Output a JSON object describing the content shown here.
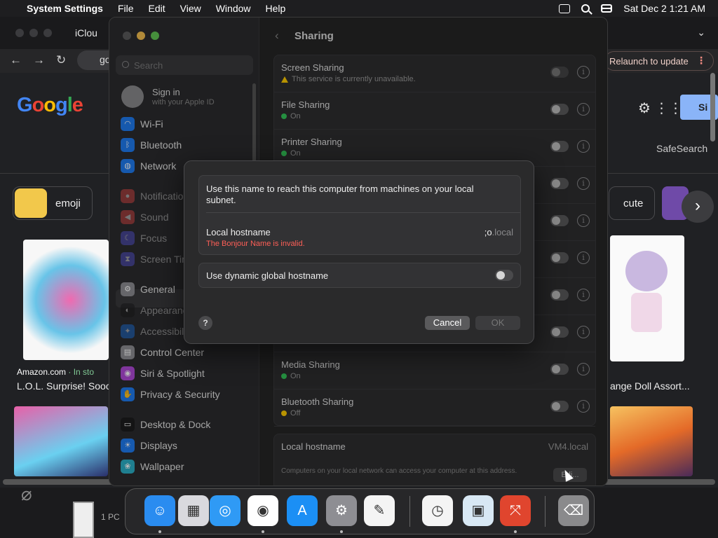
{
  "menubar": {
    "app": "System Settings",
    "items": [
      "File",
      "Edit",
      "View",
      "Window",
      "Help"
    ],
    "datetime": "Sat Dec 2  1:21 AM"
  },
  "browser": {
    "tab_title": "iClou",
    "url": "go",
    "relaunch": "Relaunch to update",
    "google": [
      "G",
      "o",
      "o",
      "g",
      "l",
      "e"
    ],
    "google_colors": [
      "#4285f4",
      "#ea4335",
      "#fbbc05",
      "#4285f4",
      "#34a853",
      "#ea4335"
    ],
    "signin": "Si",
    "safesearch": "SafeSearch",
    "chip_emoji": "emoji",
    "chip_cute": "cute",
    "source_store": "Amazon.com",
    "source_suffix": " · In sto",
    "title_left": "L.O.L. Surprise! Sooo",
    "title_right": "ange Doll Assort...",
    "taskbar_label": "1 PC"
  },
  "settings": {
    "search_placeholder": "Search",
    "signin_title": "Sign in",
    "signin_sub": "with your Apple ID",
    "sidebar": [
      {
        "label": "Wi-Fi",
        "icon": "wifi-icon",
        "color": "#1f7cf2",
        "glyph": "◠"
      },
      {
        "label": "Bluetooth",
        "icon": "bluetooth-icon",
        "color": "#1f7cf2",
        "glyph": "ᛒ"
      },
      {
        "label": "Network",
        "icon": "globe-icon",
        "color": "#1f7cf2",
        "glyph": "◍"
      },
      {
        "label": "Notificatio",
        "icon": "bell-icon",
        "color": "#ee4b4b",
        "glyph": "●"
      },
      {
        "label": "Sound",
        "icon": "speaker-icon",
        "color": "#ee4b4b",
        "glyph": "◀"
      },
      {
        "label": "Focus",
        "icon": "moon-icon",
        "color": "#5e5ce6",
        "glyph": "☾"
      },
      {
        "label": "Screen Tim",
        "icon": "hourglass-icon",
        "color": "#5e5ce6",
        "glyph": "⧗"
      },
      {
        "label": "General",
        "icon": "gear-icon",
        "color": "#8e8e93",
        "glyph": "⚙"
      },
      {
        "label": "Appearanc",
        "icon": "appearance-icon",
        "color": "#1c1c1e",
        "glyph": "◐"
      },
      {
        "label": "Accessibili",
        "icon": "accessibility-icon",
        "color": "#1f7cf2",
        "glyph": "✦"
      },
      {
        "label": "Control Center",
        "icon": "control-center-icon",
        "color": "#8e8e93",
        "glyph": "▤"
      },
      {
        "label": "Siri & Spotlight",
        "icon": "siri-icon",
        "color": "#b04ad8",
        "glyph": "◉"
      },
      {
        "label": "Privacy & Security",
        "icon": "hand-icon",
        "color": "#1f7cf2",
        "glyph": "✋"
      },
      {
        "label": "Desktop & Dock",
        "icon": "dock-icon",
        "color": "#1c1c1e",
        "glyph": "▭"
      },
      {
        "label": "Displays",
        "icon": "display-icon",
        "color": "#1f7cf2",
        "glyph": "☀"
      },
      {
        "label": "Wallpaper",
        "icon": "wallpaper-icon",
        "color": "#2bb0c8",
        "glyph": "❀"
      }
    ],
    "header": "Sharing",
    "services": [
      {
        "name": "Screen Sharing",
        "status": "This service is currently unavailable.",
        "indicator": "warning"
      },
      {
        "name": "File Sharing",
        "status": "On",
        "indicator": "green"
      },
      {
        "name": "Printer Sharing",
        "status": "On",
        "indicator": "green"
      },
      {
        "name": "",
        "status": "",
        "indicator": "none"
      },
      {
        "name": "",
        "status": "",
        "indicator": "none"
      },
      {
        "name": "",
        "status": "",
        "indicator": "none"
      },
      {
        "name": "",
        "status": "",
        "indicator": "none"
      },
      {
        "name": "",
        "status": "",
        "indicator": "none"
      },
      {
        "name": "Media Sharing",
        "status": "On",
        "indicator": "green"
      },
      {
        "name": "Bluetooth Sharing",
        "status": "Off",
        "indicator": "yellow"
      }
    ],
    "local_hostname_label": "Local hostname",
    "local_hostname_value": "VM4.local",
    "local_hostname_desc": "Computers on your local network can access your computer at this address.",
    "edit_label": "Edi..."
  },
  "dialog": {
    "description": "Use this name to reach this computer from machines on your local subnet.",
    "hostname_label": "Local hostname",
    "hostname_error": "The Bonjour Name is invalid.",
    "hostname_value": ";o",
    "hostname_suffix": ".local",
    "dynamic_label": "Use dynamic global hostname",
    "dynamic_enabled": false,
    "help": "?",
    "cancel": "Cancel",
    "ok": "OK"
  },
  "dock": [
    {
      "name": "finder-icon",
      "bg": "#2a8cf0",
      "glyph": "☺",
      "running": true
    },
    {
      "name": "launchpad-icon",
      "bg": "#d9d9de",
      "glyph": "▦",
      "running": false
    },
    {
      "name": "safari-icon",
      "bg": "#2f9af5",
      "glyph": "◎",
      "running": false
    },
    {
      "name": "chrome-icon",
      "bg": "#ffffff",
      "glyph": "◉",
      "running": true
    },
    {
      "name": "app-store-icon",
      "bg": "#1b8ff5",
      "glyph": "A",
      "running": false
    },
    {
      "name": "system-settings-icon",
      "bg": "#8e8e93",
      "glyph": "⚙",
      "running": true
    },
    {
      "name": "textedit-icon",
      "bg": "#f4f4f4",
      "glyph": "✎",
      "running": false
    },
    {
      "name": "clock-icon",
      "bg": "#f4f4f4",
      "glyph": "◷",
      "running": false
    },
    {
      "name": "preview-icon",
      "bg": "#d8e8f4",
      "glyph": "▣",
      "running": false
    },
    {
      "name": "remote-desktop-icon",
      "bg": "#e0452e",
      "glyph": "⤧",
      "running": true
    },
    {
      "name": "trash-icon",
      "bg": "#8a8a8c",
      "glyph": "⌫",
      "running": false
    }
  ]
}
